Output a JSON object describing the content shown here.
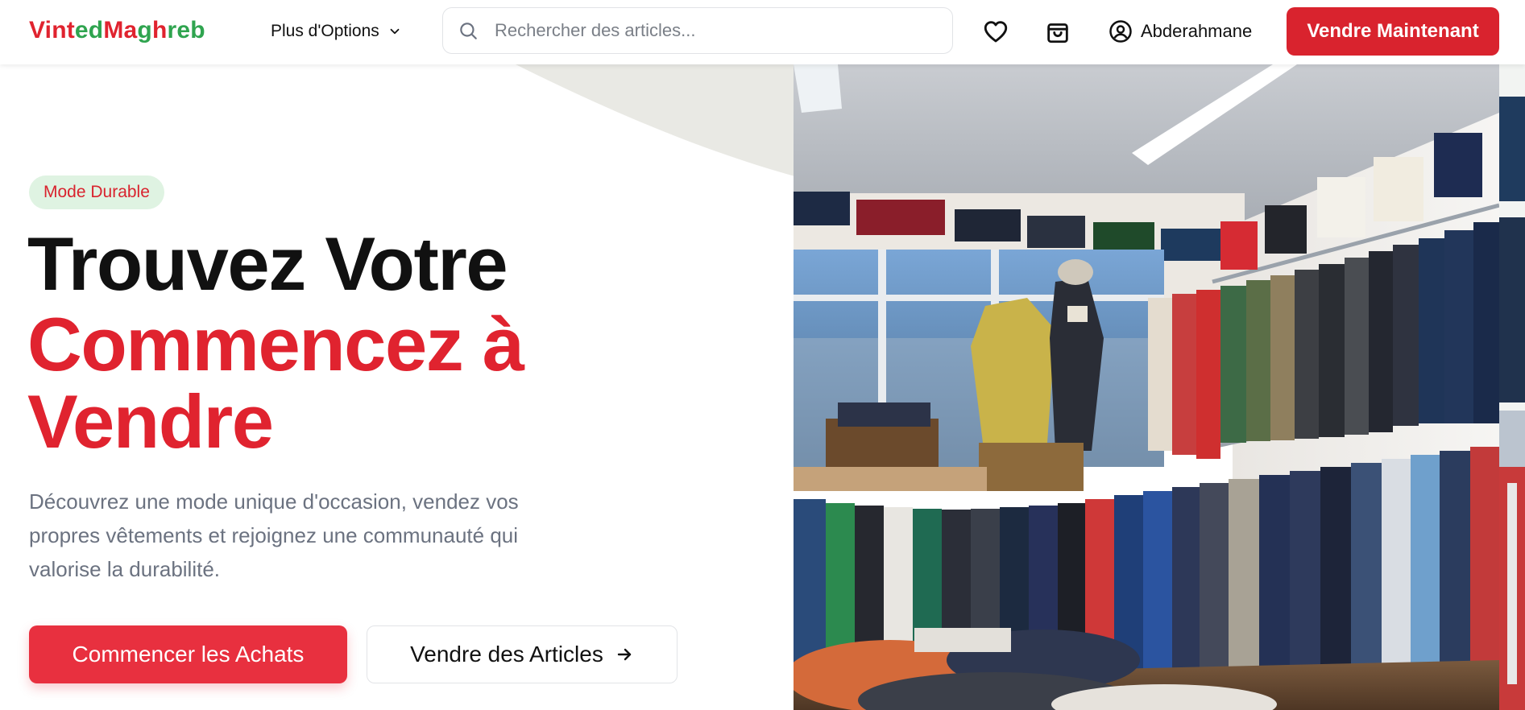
{
  "header": {
    "logo": {
      "part1": "Vint",
      "part2": "ed",
      "part3": "Ma",
      "part4": "g",
      "part5": "h",
      "part6": "reb"
    },
    "options_label": "Plus d'Options",
    "search_placeholder": "Rechercher des articles...",
    "user_name": "Abderahmane",
    "sell_now_label": "Vendre Maintenant"
  },
  "hero": {
    "badge": "Mode Durable",
    "title_line1": "Trouvez Votre",
    "title_line2": "Commencez à Vendre",
    "description": "Découvrez une mode unique d'occasion, vendez vos propres vêtements et rejoignez une communauté qui valorise la durabilité.",
    "primary_button": "Commencer les Achats",
    "secondary_button": "Vendre des Articles"
  },
  "colors": {
    "brand_red": "#e0232f",
    "brand_green": "#2fa44f",
    "button_red": "#d9232e",
    "badge_bg": "#dff3e2",
    "text_gray": "#6b7280"
  },
  "icons": {
    "options": "chevron-down-icon",
    "search": "search-icon",
    "favorites": "heart-icon",
    "cart": "shopping-bag-icon",
    "user": "user-circle-icon",
    "secondary_button": "arrow-right-icon"
  }
}
